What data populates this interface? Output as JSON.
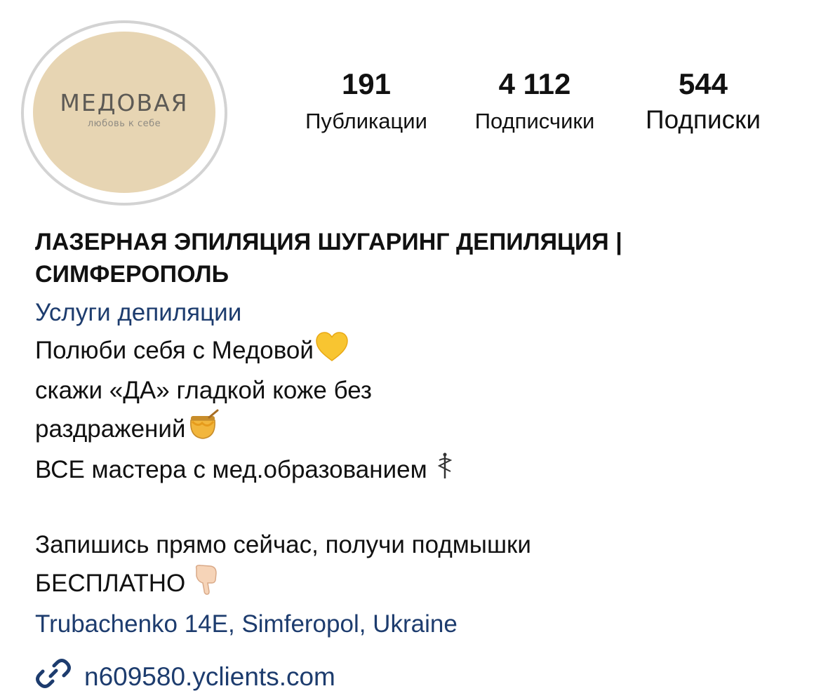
{
  "profile": {
    "avatar": {
      "brand_name": "МЕДОВАЯ",
      "tagline": "любовь к себе",
      "background_color": "#e7d5b3"
    },
    "stats": [
      {
        "value": "191",
        "label": "Публикации"
      },
      {
        "value": "4 112",
        "label": "Подписчики"
      },
      {
        "value": "544",
        "label": "Подписки"
      }
    ]
  },
  "bio": {
    "title_line1": "ЛАЗЕРНАЯ ЭПИЛЯЦИЯ ШУГАРИНГ ДЕПИЛЯЦИЯ |",
    "title_line2": "СИМФЕРОПОЛЬ",
    "category": "Услуги депиляции",
    "line1": "Полюби себя с Медовой",
    "line1_emoji": "yellow-heart-icon",
    "line2": "скажи «ДА» гладкой коже без",
    "line3": "раздражений",
    "line3_emoji": "honey-pot-icon",
    "line4": "ВСЕ мастера с мед.образованием",
    "line4_emoji": "medical-symbol-icon",
    "line5": "Запишись прямо сейчас, получи подмышки",
    "line6": "БЕСПЛАТНО",
    "line6_emoji": "pointing-down-icon",
    "address": "Trubachenko 14E, Simferopol, Ukraine"
  },
  "website": {
    "icon": "link-icon",
    "url": "n609580.yclients.com"
  },
  "colors": {
    "link": "#1d3c6e",
    "avatar_ring": "#d3d3d3",
    "text": "#111111"
  }
}
